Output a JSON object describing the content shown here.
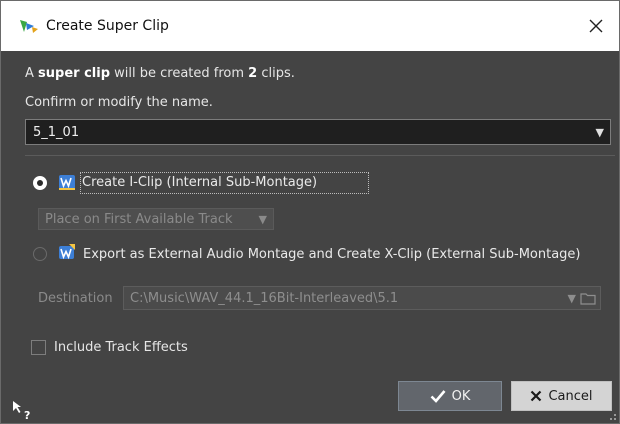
{
  "window": {
    "title": "Create Super Clip",
    "close_glyph": "✕"
  },
  "info": {
    "line1_prefix": "A ",
    "line1_bold": "super clip",
    "line1_mid": " will be created from ",
    "line1_count": "2",
    "line1_suffix": " clips.",
    "line2": "Confirm or modify the name."
  },
  "name_combo": {
    "value": "5_1_01",
    "arrow_glyph": "▼"
  },
  "options": {
    "internal": {
      "label": "Create I-Clip (Internal Sub-Montage)",
      "selected": true,
      "icon": "wavelab-montage-icon"
    },
    "placement": {
      "value": "Place on First Available Track",
      "arrow_glyph": "▼"
    },
    "external": {
      "label": "Export as External Audio Montage and Create X-Clip (External Sub-Montage)",
      "selected": false,
      "icon": "wavelab-montage-export-icon"
    }
  },
  "destination": {
    "label": "Destination",
    "path": "C:\\Music\\WAV_44.1_16Bit-Interleaved\\5.1",
    "arrow_glyph": "▼",
    "folder_icon": "folder-icon"
  },
  "include_effects": {
    "label": "Include Track Effects",
    "checked": false
  },
  "buttons": {
    "ok_label": "OK",
    "cancel_label": "Cancel"
  },
  "colors": {
    "dialog_bg": "#444444",
    "title_bg": "#ffffff",
    "icon_blue": "#3d7fd6",
    "ok_bg": "#62666c",
    "cancel_bg": "#d4d4d4"
  }
}
